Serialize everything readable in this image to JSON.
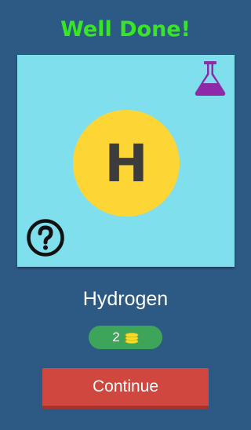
{
  "header": {
    "title": "Well Done!"
  },
  "card": {
    "element_symbol": "H",
    "top_right_icon": "flask-icon",
    "bottom_left_icon": "question-icon"
  },
  "element_name": "Hydrogen",
  "reward": {
    "count": "2",
    "icon": "coins-icon"
  },
  "continue_label": "Continue",
  "colors": {
    "background": "#2d5a84",
    "title": "#39e626",
    "card": "#80dfec",
    "circle": "#fdd535",
    "flask": "#8e2aa8",
    "pill": "#3da55a",
    "coin": "#f5dd2a",
    "button": "#d0473f"
  }
}
